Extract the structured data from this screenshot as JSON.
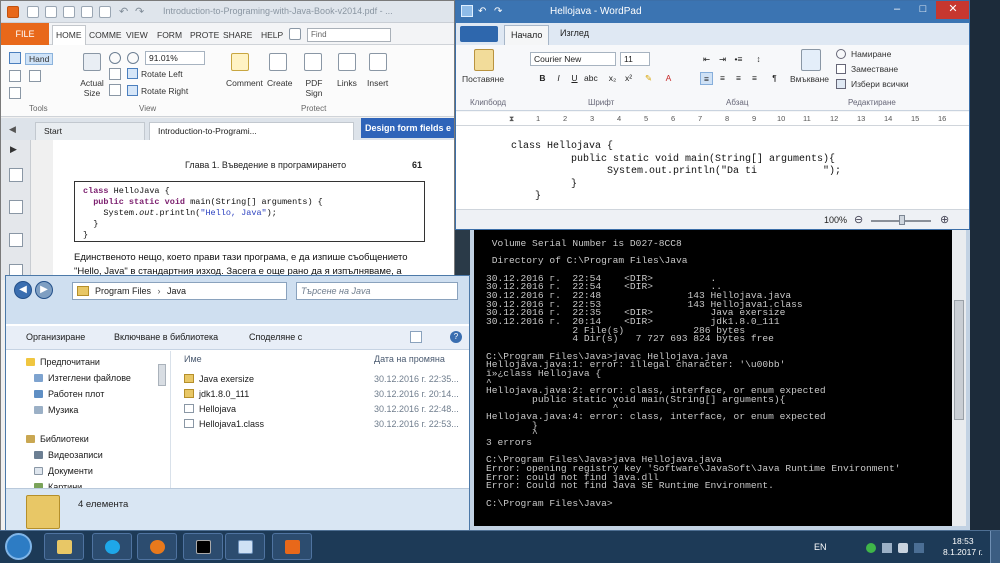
{
  "pdf": {
    "doc_title": "Introduction-to-Programing-with-Java-Book-v2014.pdf - ...",
    "file_tab": "FILE",
    "tabs": [
      "HOME",
      "COMME",
      "VIEW",
      "FORM",
      "PROTE",
      "SHARE",
      "HELP"
    ],
    "find_placeholder": "Find",
    "tools": {
      "hand": "Hand",
      "group": "Tools"
    },
    "view": {
      "zoom": "91.01%",
      "actual_size": "Actual Size",
      "rotate_left": "Rotate Left",
      "rotate_right": "Rotate Right",
      "group": "View"
    },
    "comment": "Comment",
    "create": "Create",
    "pdf_sign": "PDF Sign",
    "protect_group": "Protect",
    "links": "Links",
    "insert": "Insert",
    "doc_tabs": [
      "Start",
      "Introduction-to-Programi..."
    ],
    "banner": "Design form fields e",
    "chapter_header": "Глава 1. Въведение в програмирането",
    "page_number": "61",
    "body_text": "Единственото нещо, което прави тази програма, е да изпише съобщението \"Hello, Java\" в стандартния изход. Засега е още рано да я изпълняваме, а"
  },
  "wordpad": {
    "title": "Hellojava - WordPad",
    "tabs": [
      "Начало",
      "Изглед"
    ],
    "paste": "Поставяне",
    "clipboard_group": "Клипборд",
    "font_name": "Courier New",
    "font_size": "11",
    "font_group": "Шрифт",
    "paragraph_group": "Абзац",
    "insert_btn": "Вмъкване",
    "find": "Намиране",
    "replace": "Заместване",
    "select_all": "Избери всички",
    "editing_group": "Редактиране",
    "zoom": "100%",
    "ruler": [
      "1",
      "2",
      "3",
      "4",
      "5",
      "6",
      "7",
      "8",
      "9",
      "10",
      "11",
      "12",
      "13",
      "14",
      "15",
      "16"
    ]
  },
  "console": {
    "lines": [
      " Volume Serial Number is D027-8CC8",
      "",
      " Directory of C:\\Program Files\\Java",
      "",
      "30.12.2016 г.  22:54    <DIR>          .",
      "30.12.2016 г.  22:54    <DIR>          ..",
      "30.12.2016 г.  22:48               143 Hellojava.java",
      "30.12.2016 г.  22:53               143 Hellojava1.class",
      "30.12.2016 г.  22:35    <DIR>          Java exersize",
      "30.12.2016 г.  20:14    <DIR>          jdk1.8.0_111",
      "               2 File(s)            286 bytes",
      "               4 Dir(s)   7 727 693 824 bytes free",
      "",
      "C:\\Program Files\\Java>javac Hellojava.java",
      "Hellojava.java:1: error: illegal character: '\\u00bb'",
      "ï»¿class Hellojava {",
      "^",
      "Hellojava.java:2: error: class, interface, or enum expected",
      "        public static void main(String[] arguments){",
      "                      ^",
      "Hellojava.java:4: error: class, interface, or enum expected",
      "        }",
      "        ^",
      "3 errors",
      "",
      "C:\\Program Files\\Java>java Hellojava.java",
      "Error: opening registry key 'Software\\JavaSoft\\Java Runtime Environment'",
      "Error: could not find java.dll",
      "Error: Could not find Java SE Runtime Environment.",
      "",
      "C:\\Program Files\\Java>"
    ]
  },
  "explorer": {
    "breadcrumb": [
      "Program Files",
      "Java"
    ],
    "search_placeholder": "Търсене на Java",
    "commands": [
      "Организиране",
      "Включване в библиотека",
      "Споделяне с"
    ],
    "nav": {
      "favorites": "Предпочитани",
      "downloads": "Изтеглени файлове",
      "desktop": "Работен плот",
      "music": "Музика",
      "libraries": "Библиотеки",
      "videos": "Видеозаписи",
      "documents": "Документи",
      "pictures": "Картини"
    },
    "col_name": "Име",
    "col_date": "Дата на промяна",
    "files": [
      {
        "name": "Java exersize",
        "date": "30.12.2016 г. 22:35..."
      },
      {
        "name": "jdk1.8.0_111",
        "date": "30.12.2016 г. 20:14..."
      },
      {
        "name": "Hellojava",
        "date": "30.12.2016 г. 22:48..."
      },
      {
        "name": "Hellojava1.class",
        "date": "30.12.2016 г. 22:53..."
      }
    ],
    "status": "4 елемента"
  },
  "taskbar": {
    "lang": "EN",
    "time": "18:53",
    "date": "8.1.2017 г."
  }
}
